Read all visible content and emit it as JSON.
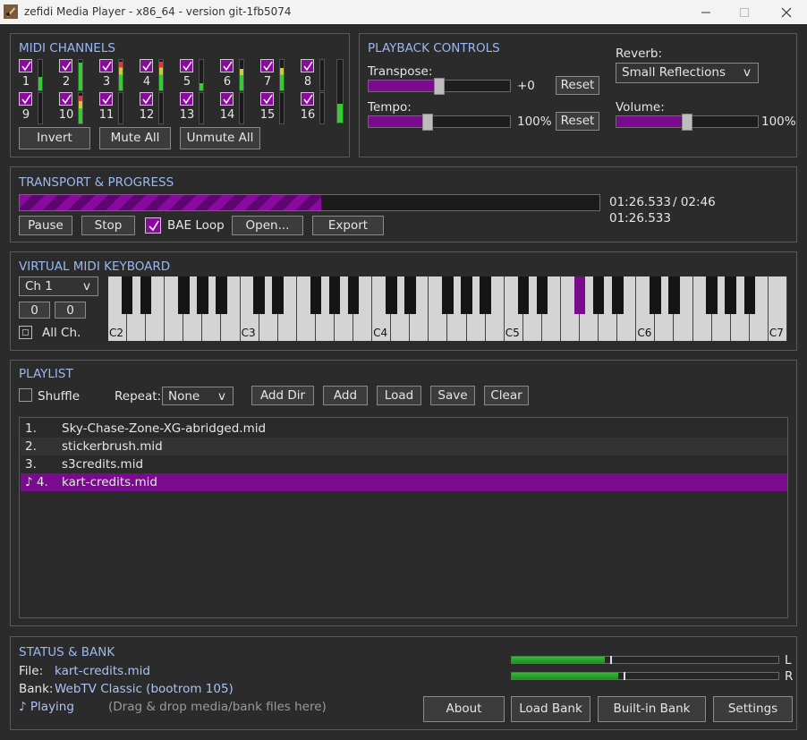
{
  "window": {
    "title": "zefidi Media Player - x86_64 - version git-1fb5074"
  },
  "midi_channels": {
    "title": "MIDI CHANNELS",
    "channels": [
      {
        "num": "1",
        "checked": true,
        "level": 0.45,
        "color": "#3c3"
      },
      {
        "num": "2",
        "checked": true,
        "level": 0.9,
        "color": "#3c3"
      },
      {
        "num": "3",
        "checked": true,
        "level": 0.95,
        "color": "#e33"
      },
      {
        "num": "4",
        "checked": true,
        "level": 0.95,
        "color": "#e33"
      },
      {
        "num": "5",
        "checked": true,
        "level": 0.25,
        "color": "#3c3"
      },
      {
        "num": "6",
        "checked": true,
        "level": 0.7,
        "color": "#cc3"
      },
      {
        "num": "7",
        "checked": true,
        "level": 0.75,
        "color": "#cc3"
      },
      {
        "num": "8",
        "checked": true,
        "level": 0.0,
        "color": "#3c3"
      },
      {
        "num": "9",
        "checked": true,
        "level": 0.0,
        "color": "#3c3"
      },
      {
        "num": "10",
        "checked": true,
        "level": 0.9,
        "color": "#e33"
      },
      {
        "num": "11",
        "checked": true,
        "level": 0.0,
        "color": "#3c3"
      },
      {
        "num": "12",
        "checked": true,
        "level": 0.0,
        "color": "#3c3"
      },
      {
        "num": "13",
        "checked": true,
        "level": 0.0,
        "color": "#3c3"
      },
      {
        "num": "14",
        "checked": true,
        "level": 0.0,
        "color": "#3c3"
      },
      {
        "num": "15",
        "checked": true,
        "level": 0.0,
        "color": "#3c3"
      },
      {
        "num": "16",
        "checked": true,
        "level": 0.0,
        "color": "#3c3"
      }
    ],
    "master_level": 0.3,
    "invert_label": "Invert",
    "mute_all_label": "Mute All",
    "unmute_all_label": "Unmute All"
  },
  "playback": {
    "title": "PLAYBACK CONTROLS",
    "transpose_label": "Transpose:",
    "transpose_value": "+0",
    "transpose_level": 0.5,
    "tempo_label": "Tempo:",
    "tempo_value": "100%",
    "tempo_level": 0.42,
    "reset_label": "Reset",
    "reverb_label": "Reverb:",
    "reverb_value": "Small Reflections",
    "volume_label": "Volume:",
    "volume_value": "100%",
    "volume_level": 0.5
  },
  "transport": {
    "title": "TRANSPORT & PROGRESS",
    "progress": 0.52,
    "time_current": "01:26.533",
    "time_total": "/ 02:46",
    "time_second": "01:26.533",
    "pause_label": "Pause",
    "stop_label": "Stop",
    "bae_loop_label": "BAE Loop",
    "bae_loop_checked": true,
    "open_label": "Open...",
    "export_label": "Export"
  },
  "keyboard": {
    "title": "VIRTUAL MIDI KEYBOARD",
    "channel_value": "Ch 1",
    "field1": "0",
    "field2": "0",
    "all_ch_label": "All Ch.",
    "octave_labels": [
      "C2",
      "C3",
      "C4",
      "C5",
      "C6",
      "C7"
    ],
    "active_black_key_index": 17
  },
  "playlist": {
    "title": "PLAYLIST",
    "shuffle_label": "Shuffle",
    "repeat_label": "Repeat:",
    "repeat_value": "None",
    "add_dir_label": "Add Dir",
    "add_label": "Add",
    "load_label": "Load",
    "save_label": "Save",
    "clear_label": "Clear",
    "items": [
      {
        "num": "1.",
        "title": "Sky-Chase-Zone-XG-abridged.mid",
        "playing": false
      },
      {
        "num": "2.",
        "title": "stickerbrush.mid",
        "playing": false
      },
      {
        "num": "3.",
        "title": "s3credits.mid",
        "playing": false
      },
      {
        "num": "♪ 4.",
        "title": "kart-credits.mid",
        "playing": true
      }
    ]
  },
  "status": {
    "title": "STATUS & BANK",
    "file_label": "File:",
    "file_value": "kart-credits.mid",
    "bank_label": "Bank:",
    "bank_value": "WebTV Classic (bootrom 105)",
    "playing_text": "♪ Playing",
    "hint_text": "(Drag & drop media/bank files here)",
    "vu_left_label": "L",
    "vu_right_label": "R",
    "vu_left_level": 0.35,
    "vu_right_level": 0.4,
    "about_label": "About",
    "load_bank_label": "Load Bank",
    "builtin_bank_label": "Built-in Bank",
    "settings_label": "Settings"
  },
  "colors": {
    "accent": "#7a0a8e",
    "panel_title": "#9ab8f0",
    "background": "#2b2b2b"
  }
}
